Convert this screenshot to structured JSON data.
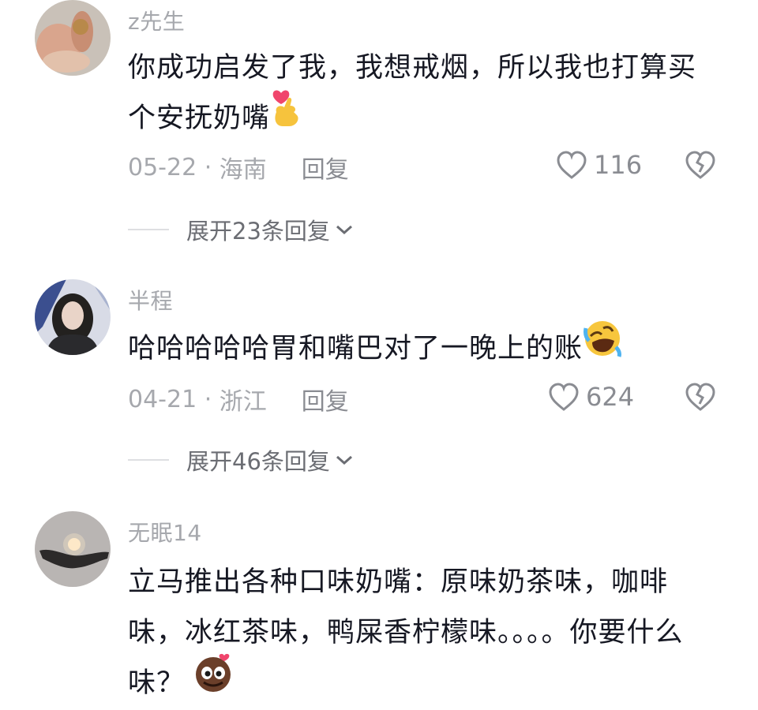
{
  "comments": [
    {
      "username": "z先生",
      "text": "你成功启发了我，我想戒烟，所以我也打算买个安抚奶嘴",
      "text_emoji": "finger-heart-emoji",
      "date": "05-22",
      "separator": " · ",
      "location": "海南",
      "reply_label": "回复",
      "likes": "116",
      "expand_label": "展开23条回复"
    },
    {
      "username": "半程",
      "text": "哈哈哈哈哈胃和嘴巴对了一晚上的账",
      "text_emoji": "rolling-laughing-emoji",
      "date": "04-21",
      "separator": " · ",
      "location": "浙江",
      "reply_label": "回复",
      "likes": "624",
      "expand_label": "展开46条回复"
    },
    {
      "username": "无眠14",
      "text": "立马推出各种口味奶嘴：原味奶茶味，咖啡味，冰红茶味，鸭屎香柠檬味。。。。你要什么味？",
      "text_emoji": "cheeky-face-emoji"
    }
  ],
  "colors": {
    "username": "#a6a8ad",
    "body_text": "#161823",
    "meta": "#a6a8ad",
    "divider": "#dedfe2"
  }
}
